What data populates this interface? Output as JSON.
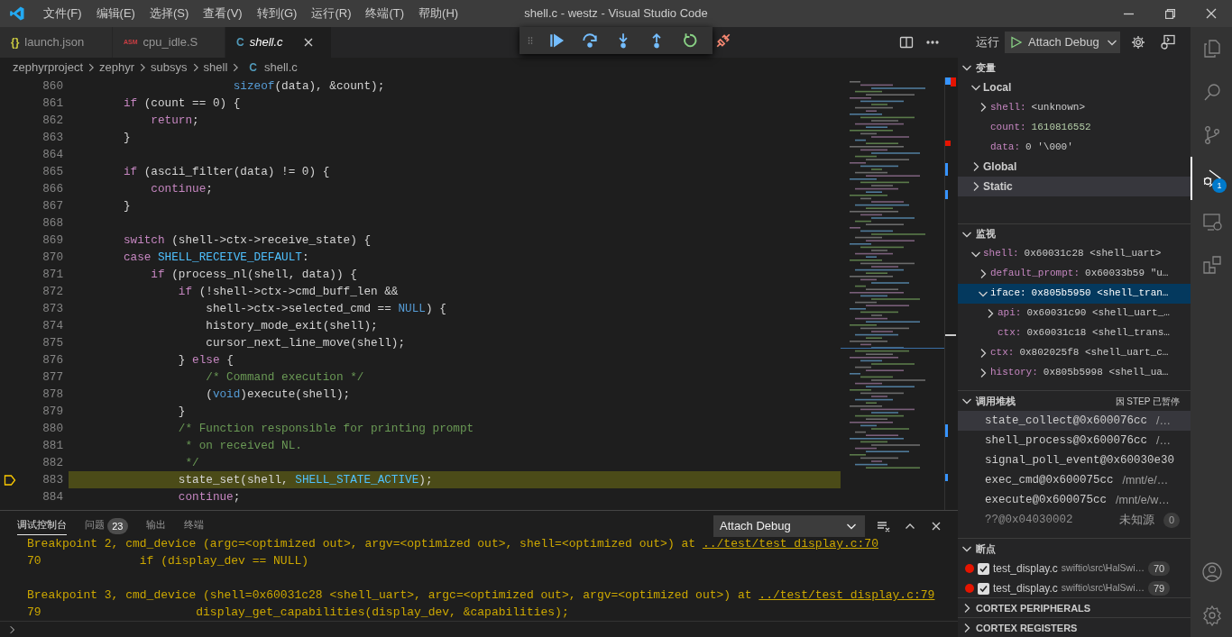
{
  "title_bar": {
    "menus": [
      "文件(F)",
      "编辑(E)",
      "选择(S)",
      "查看(V)",
      "转到(G)",
      "运行(R)",
      "终端(T)",
      "帮助(H)"
    ],
    "title": "shell.c - westz - Visual Studio Code"
  },
  "editor_tabs": [
    {
      "label": "launch.json",
      "icon": "{}",
      "color": "#cbcb41",
      "selected": false,
      "preview": false
    },
    {
      "label": "cpu_idle.S",
      "icon": "ASM",
      "color": "#cc3e44",
      "selected": false,
      "preview": false
    },
    {
      "label": "shell.c",
      "icon": "C",
      "color": "#519aba",
      "selected": true,
      "preview": true
    }
  ],
  "breadcrumb": {
    "folders": [
      "zephyrproject",
      "zephyr",
      "subsys",
      "shell"
    ],
    "file": {
      "icon": "C",
      "label": "shell.c"
    }
  },
  "code": [
    {
      "number": "860",
      "current": false,
      "tokens": [
        {
          "kind": "t",
          "t": "                        sizeof"
        },
        {
          "kind": "p",
          "t": "(data), &count);"
        }
      ]
    },
    {
      "number": "861",
      "current": false,
      "tokens": [
        {
          "kind": "k",
          "t": "        if"
        },
        {
          "kind": "p",
          "t": " (count == 0) {"
        }
      ]
    },
    {
      "number": "862",
      "current": false,
      "tokens": [
        {
          "kind": "k",
          "t": "            return"
        },
        {
          "kind": "p",
          "t": ";"
        }
      ]
    },
    {
      "number": "863",
      "current": false,
      "tokens": [
        {
          "kind": "p",
          "t": "        }"
        }
      ]
    },
    {
      "number": "864",
      "current": false
    },
    {
      "number": "865",
      "current": false,
      "tokens": [
        {
          "kind": "k",
          "t": "        if"
        },
        {
          "kind": "p",
          "t": " (ascii_filter(data) != 0) {"
        }
      ]
    },
    {
      "number": "866",
      "current": false,
      "tokens": [
        {
          "kind": "k",
          "t": "            continue"
        },
        {
          "kind": "p",
          "t": ";"
        }
      ]
    },
    {
      "number": "867",
      "current": false,
      "tokens": [
        {
          "kind": "p",
          "t": "        }"
        }
      ]
    },
    {
      "number": "868",
      "current": false
    },
    {
      "number": "869",
      "current": false,
      "tokens": [
        {
          "kind": "k",
          "t": "        switch"
        },
        {
          "kind": "p",
          "t": " (shell->ctx->receive_state) {"
        }
      ]
    },
    {
      "number": "870",
      "current": false,
      "tokens": [
        {
          "kind": "k",
          "t": "        case "
        },
        {
          "kind": "c",
          "t": "SHELL_RECEIVE_DEFAULT"
        },
        {
          "kind": "p",
          "t": ":"
        }
      ]
    },
    {
      "number": "871",
      "current": false,
      "tokens": [
        {
          "kind": "k",
          "t": "            if"
        },
        {
          "kind": "p",
          "t": " (process_nl(shell, data)) {"
        }
      ]
    },
    {
      "number": "872",
      "current": false,
      "tokens": [
        {
          "kind": "k",
          "t": "                if"
        },
        {
          "kind": "p",
          "t": " (!shell->ctx->cmd_buff_len &&"
        }
      ]
    },
    {
      "number": "873",
      "current": false,
      "tokens": [
        {
          "kind": "p",
          "t": "                    shell->ctx->selected_cmd == "
        },
        {
          "kind": "t",
          "t": "NULL"
        },
        {
          "kind": "p",
          "t": ") {"
        }
      ]
    },
    {
      "number": "874",
      "current": false,
      "tokens": [
        {
          "kind": "p",
          "t": "                    history_mode_exit(shell);"
        }
      ]
    },
    {
      "number": "875",
      "current": false,
      "tokens": [
        {
          "kind": "p",
          "t": "                    cursor_next_line_move(shell);"
        }
      ]
    },
    {
      "number": "876",
      "current": false,
      "tokens": [
        {
          "kind": "p",
          "t": "                } "
        },
        {
          "kind": "k",
          "t": "else"
        },
        {
          "kind": "p",
          "t": " {"
        }
      ]
    },
    {
      "number": "877",
      "current": false,
      "tokens": [
        {
          "kind": "m",
          "t": "                    /* Command execution */"
        }
      ]
    },
    {
      "number": "878",
      "current": false,
      "tokens": [
        {
          "kind": "p",
          "t": "                    ("
        },
        {
          "kind": "t",
          "t": "void"
        },
        {
          "kind": "p",
          "t": ")execute(shell);"
        }
      ]
    },
    {
      "number": "879",
      "current": false,
      "tokens": [
        {
          "kind": "p",
          "t": "                }"
        }
      ]
    },
    {
      "number": "880",
      "current": false,
      "tokens": [
        {
          "kind": "m",
          "t": "                /* Function responsible for printing prompt"
        }
      ]
    },
    {
      "number": "881",
      "current": false,
      "tokens": [
        {
          "kind": "m",
          "t": "                 * on received NL."
        }
      ]
    },
    {
      "number": "882",
      "current": false,
      "tokens": [
        {
          "kind": "m",
          "t": "                 */"
        }
      ]
    },
    {
      "number": "883",
      "current": true,
      "tokens": [
        {
          "kind": "p",
          "t": "                state_set(shell, "
        },
        {
          "kind": "c",
          "t": "SHELL_STATE_ACTIVE"
        },
        {
          "kind": "p",
          "t": ");"
        }
      ]
    },
    {
      "number": "884",
      "current": false,
      "tokens": [
        {
          "kind": "k",
          "t": "                continue"
        },
        {
          "kind": "p",
          "t": ";"
        }
      ]
    }
  ],
  "debug_toolbar": [
    {
      "kind": "grip"
    },
    {
      "kind": "continue"
    },
    {
      "kind": "step-over"
    },
    {
      "kind": "step-into"
    },
    {
      "kind": "step-out"
    },
    {
      "kind": "restart"
    },
    {
      "kind": "disconnect"
    }
  ],
  "panel": {
    "tabs": [
      {
        "label": "调试控制台",
        "selected": true
      },
      {
        "label": "问题",
        "selected": false,
        "badge": "23"
      },
      {
        "label": "输出",
        "selected": false
      },
      {
        "label": "终端",
        "selected": false
      }
    ],
    "dropdown": "Attach Debug",
    "console": [
      {
        "kind": "breakpoint",
        "text": "Breakpoint 2, cmd_device (argc=<optimized out>, argv=<optimized out>, shell=<optimized out>) at ",
        "link": "../test/test_display.c:70"
      },
      {
        "kind": "source",
        "text": "70              if (display_dev == NULL)"
      },
      {
        "kind": "breakpoint",
        "text": "Breakpoint 3, cmd_device (shell=0x60031c28 <shell_uart>, argc=<optimized out>, argv=<optimized out>) at ",
        "link": "../test/test_display.c:79"
      },
      {
        "kind": "source",
        "text": "79                      display_get_capabilities(display_dev, &capabilities);"
      }
    ]
  },
  "sidebar": {
    "run_label": "运行",
    "config": "Attach Debug",
    "variables": {
      "title": "变量",
      "expanded": true,
      "items": [
        {
          "name": "Local",
          "expanded": true,
          "selected": false,
          "children": [
            {
              "name": "shell:",
              "value": "<unknown>",
              "expanded": false,
              "selected": false
            },
            {
              "name": "count:",
              "value": "1610816552",
              "kind": "number",
              "selected": false
            },
            {
              "name": "data:",
              "value": "0 '\\000'",
              "selected": false
            }
          ]
        },
        {
          "name": "Global",
          "expanded": false,
          "selected": false
        },
        {
          "name": "Static",
          "expanded": false,
          "selected": true
        }
      ]
    },
    "watch": {
      "title": "监视",
      "expanded": true,
      "items": [
        {
          "name": "shell:",
          "value": "0x60031c28 <shell_uart>",
          "expanded": true,
          "selected": false,
          "children": [
            {
              "name": "default_prompt:",
              "value": "0x60033b59 \"u…",
              "expanded": false,
              "selected": false
            },
            {
              "name": "iface:",
              "value": "0x805b5950 <shell_tran…",
              "expanded": true,
              "selected": true,
              "children": [
                {
                  "name": "api:",
                  "value": "0x60031c90 <shell_uart_…",
                  "expanded": false,
                  "selected": false
                },
                {
                  "name": "ctx:",
                  "value": "0x60031c18 <shell_trans…",
                  "selected": false
                }
              ]
            },
            {
              "name": "ctx:",
              "value": "0x802025f8 <shell_uart_c…",
              "expanded": false,
              "selected": false
            },
            {
              "name": "history:",
              "value": "0x805b5998 <shell_ua…",
              "expanded": false,
              "selected": false
            }
          ]
        }
      ]
    },
    "call_stack": {
      "title": "调用堆栈",
      "expanded": true,
      "status": "因 STEP 已暂停",
      "frames": [
        {
          "name": "state_collect@0x600076cc",
          "source": "/…",
          "selected": true,
          "disabled": false
        },
        {
          "name": "shell_process@0x600076cc",
          "source": "/…",
          "selected": false,
          "disabled": false
        },
        {
          "name": "signal_poll_event@0x60030e30",
          "selected": false,
          "disabled": false
        },
        {
          "name": "exec_cmd@0x600075cc",
          "source": "/mnt/e/…",
          "selected": false,
          "disabled": false
        },
        {
          "name": "execute@0x600075cc",
          "source": "/mnt/e/w…",
          "selected": false,
          "disabled": false
        },
        {
          "name": "??@0x04030002",
          "source": "未知源",
          "badge": "0",
          "selected": false,
          "disabled": true
        }
      ]
    },
    "breakpoints": {
      "title": "断点",
      "expanded": true,
      "items": [
        {
          "file": "test_display.c",
          "path": "swiftio\\src\\HalSwi…",
          "line": "70",
          "checked": true,
          "color": "#e51400"
        },
        {
          "file": "test_display.c",
          "path": "swiftio\\src\\HalSwi…",
          "line": "79",
          "checked": true,
          "color": "#e51400"
        }
      ]
    },
    "collapsed_sections": [
      {
        "title": "CORTEX PERIPHERALS",
        "expanded": false
      },
      {
        "title": "CORTEX REGISTERS",
        "expanded": false
      }
    ]
  },
  "activity_bar": {
    "top": [
      {
        "kind": "explorer",
        "selected": false
      },
      {
        "kind": "search",
        "selected": false
      },
      {
        "kind": "source-control",
        "selected": false
      },
      {
        "kind": "run-debug",
        "selected": true,
        "badge": "1"
      },
      {
        "kind": "remote",
        "selected": false
      },
      {
        "kind": "extensions",
        "selected": false
      }
    ],
    "bottom": [
      {
        "kind": "account"
      },
      {
        "kind": "settings"
      }
    ]
  }
}
